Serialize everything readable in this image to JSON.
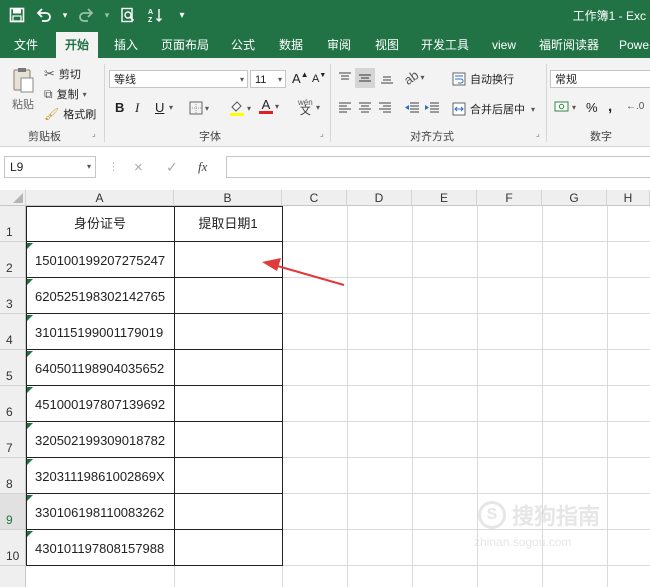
{
  "title_bar": {
    "document_title": "工作簿1 - Exc"
  },
  "quick_access": [
    {
      "name": "save-icon",
      "glyph": "🖫"
    },
    {
      "name": "undo-icon",
      "glyph": "↶"
    },
    {
      "name": "redo-icon",
      "glyph": "↷"
    },
    {
      "name": "print-preview-icon",
      "glyph": "🔍"
    },
    {
      "name": "sort-icon",
      "glyph": "⇅"
    },
    {
      "name": "customize-icon",
      "glyph": "▾"
    }
  ],
  "tabs": [
    "文件",
    "开始",
    "插入",
    "页面布局",
    "公式",
    "数据",
    "审阅",
    "视图",
    "开发工具",
    "view",
    "福昕阅读器",
    "Powe"
  ],
  "ribbon": {
    "clipboard": {
      "paste": "粘贴",
      "cut": "剪切",
      "copy": "复制",
      "format_painter": "格式刷",
      "group": "剪贴板"
    },
    "font": {
      "font_name": "等线",
      "font_size": "11",
      "grow": "A",
      "shrink": "A",
      "bold": "B",
      "italic": "I",
      "underline": "U",
      "wen": "wén",
      "group": "字体"
    },
    "alignment": {
      "wrap": "自动换行",
      "merge": "合并后居中",
      "group": "对齐方式"
    },
    "number": {
      "format": "常规",
      "percent": "%",
      "comma": ",",
      "group": "数字"
    }
  },
  "formula_bar": {
    "name_box": "L9",
    "cancel": "×",
    "enter": "✓",
    "fx": "fx",
    "value": ""
  },
  "columns": [
    "A",
    "B",
    "C",
    "D",
    "E",
    "F",
    "G",
    "H"
  ],
  "rows": [
    "1",
    "2",
    "3",
    "4",
    "5",
    "6",
    "7",
    "8",
    "9",
    "10"
  ],
  "table": {
    "headers": [
      "身份证号",
      "提取日期1"
    ],
    "ids": [
      "150100199207275247",
      "620525198302142765",
      "310115199001179019",
      "640501198904035652",
      "451000197807139692",
      "320502199309018782",
      "32031119861002869X",
      "330106198110083262",
      "430101197808157988"
    ]
  },
  "watermark": {
    "brand": "搜狗指南",
    "url": "zhinan.sogou.com"
  },
  "colors": {
    "excel_green": "#217346",
    "arrow_red": "#e03a3a"
  }
}
